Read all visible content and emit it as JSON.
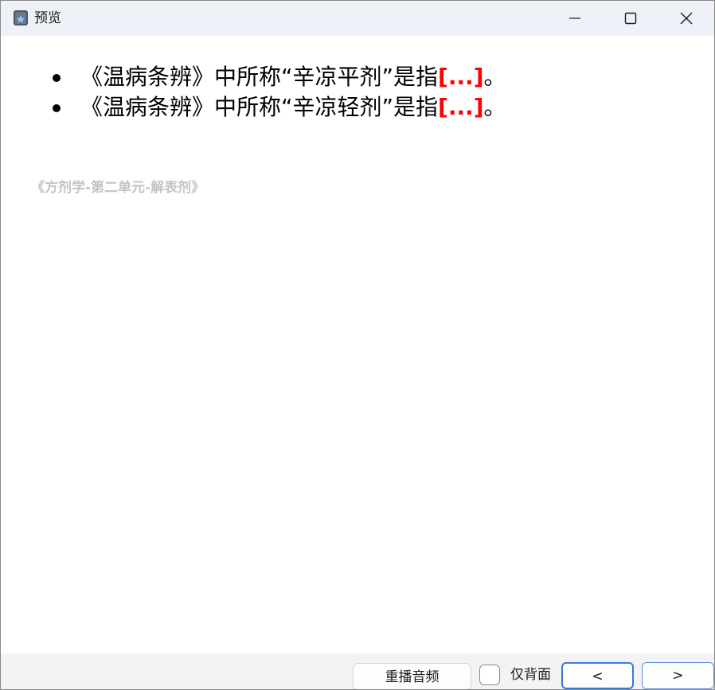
{
  "window": {
    "title": "预览",
    "controls": {
      "minimize_icon": "minimize-icon",
      "maximize_icon": "maximize-icon",
      "close_icon": "close-icon"
    }
  },
  "card": {
    "items": [
      {
        "text": "《温病条辨》中所称“辛凉平剂”是指",
        "cloze": "[...]",
        "suffix": "。"
      },
      {
        "text": "《温病条辨》中所称“辛凉轻剂”是指",
        "cloze": "[...]",
        "suffix": "。"
      }
    ],
    "deck": "《方剂学-第二单元-解表剂》"
  },
  "bottom_bar": {
    "replay_label": "重播音频",
    "back_only_label": "仅背面",
    "back_only_checked": false,
    "prev_label": "<",
    "next_label": ">"
  },
  "colors": {
    "cloze": "#ff0000",
    "titlebar_bg": "#eef2f8",
    "bottombar_bg": "#f3f3f3",
    "deck_text": "#c4c4c4",
    "focus_border": "#3a78d6"
  }
}
